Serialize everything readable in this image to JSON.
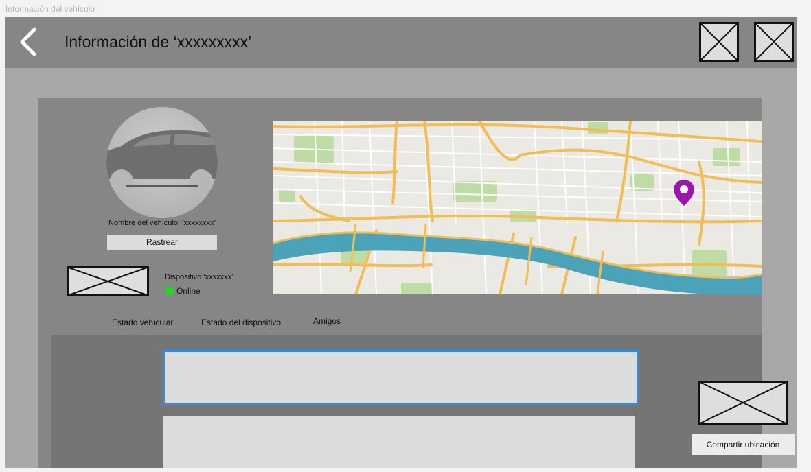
{
  "frame": {
    "label": "Información del vehículo"
  },
  "header": {
    "title": "Información de ‘xxxxxxxxx’",
    "back_icon": "chevron-left-icon",
    "actions": [
      {
        "icon": "image-placeholder-icon"
      },
      {
        "icon": "image-placeholder-icon"
      }
    ]
  },
  "vehicle": {
    "image_icon": "car-icon",
    "name_label": "Nombre del vehículo: ‘xxxxxxxx’",
    "track_button": "Rastrear"
  },
  "device": {
    "image_icon": "image-placeholder-icon",
    "name": "Dispositivo ‘xxxxxxx’",
    "status": "Online",
    "status_color": "#12e212"
  },
  "map": {
    "marker_icon": "map-pin-icon",
    "marker_color": "#9b16ab"
  },
  "tabs": [
    {
      "label": "Estado vehícular"
    },
    {
      "label": "Estado del dispositivo"
    },
    {
      "label": "Amigos"
    }
  ],
  "share": {
    "image_icon": "image-placeholder-icon",
    "button_label": "Compartir ubicación"
  },
  "colors": {
    "header_bg": "#868686",
    "page_bg": "#a8a8a8",
    "selected_outline": "#2b8fe8"
  }
}
